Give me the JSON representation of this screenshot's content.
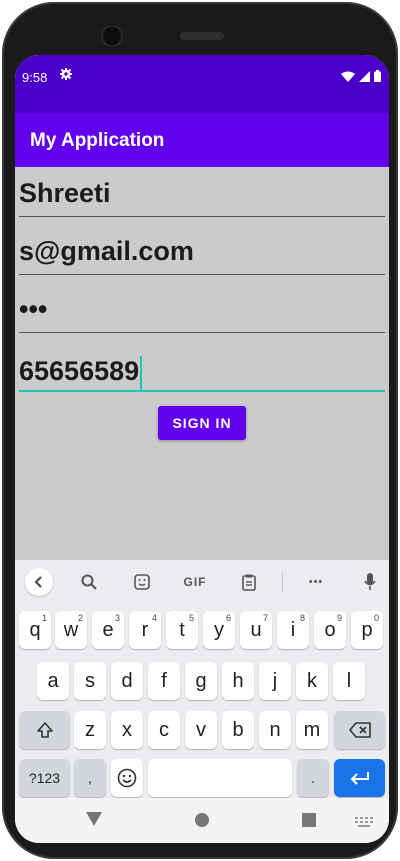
{
  "status_bar": {
    "time": "9:58",
    "gear_icon": "gear-icon",
    "wifi_icon": "wifi-icon",
    "signal_icon": "signal-icon",
    "battery_icon": "battery-icon"
  },
  "app_bar": {
    "title": "My Application"
  },
  "form": {
    "name": "Shreeti",
    "email": "s@gmail.com",
    "password": "•••",
    "phone": "65656589",
    "sign_in_label": "SIGN IN"
  },
  "keyboard": {
    "toolbar": {
      "gif_label": "GIF",
      "more_label": "•••"
    },
    "row1": [
      {
        "k": "q",
        "h": "1"
      },
      {
        "k": "w",
        "h": "2"
      },
      {
        "k": "e",
        "h": "3"
      },
      {
        "k": "r",
        "h": "4"
      },
      {
        "k": "t",
        "h": "5"
      },
      {
        "k": "y",
        "h": "6"
      },
      {
        "k": "u",
        "h": "7"
      },
      {
        "k": "i",
        "h": "8"
      },
      {
        "k": "o",
        "h": "9"
      },
      {
        "k": "p",
        "h": "0"
      }
    ],
    "row2": [
      "a",
      "s",
      "d",
      "f",
      "g",
      "h",
      "j",
      "k",
      "l"
    ],
    "row3": [
      "z",
      "x",
      "c",
      "v",
      "b",
      "n",
      "m"
    ],
    "symbols_label": "?123",
    "comma_label": ",",
    "period_label": "."
  },
  "colors": {
    "status_bar": "#4b00c9",
    "app_bar": "#6200ee",
    "accent": "#1ec4b5",
    "enter_key": "#1a73e8"
  }
}
